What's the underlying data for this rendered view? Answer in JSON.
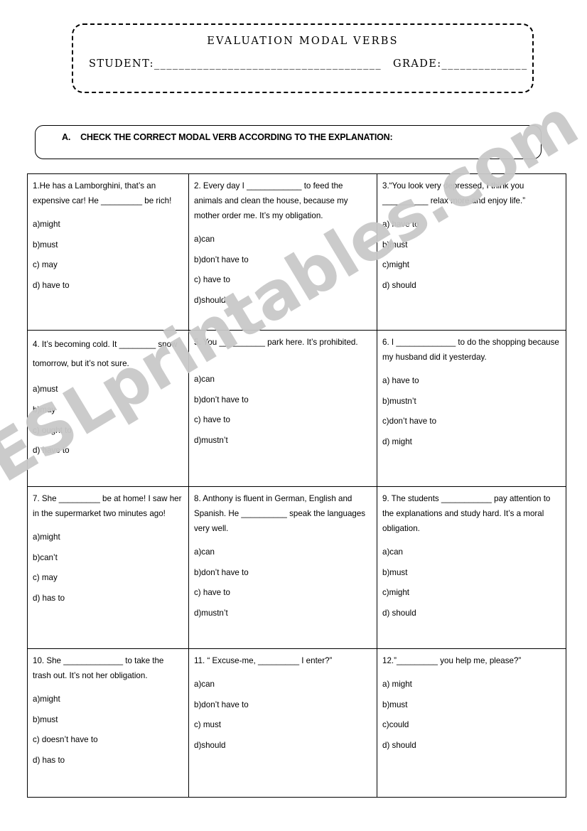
{
  "header": {
    "title": "EVALUATION MODAL VERBS",
    "student_label": "STUDENT:",
    "student_blank": "_____________________________________",
    "grade_label": "GRADE:",
    "grade_blank": "______________"
  },
  "instruction": {
    "letter": "A.",
    "text": "CHECK THE CORRECT MODAL VERB ACCORDING TO THE EXPLANATION:"
  },
  "watermark": {
    "text": "ESLprintables.com",
    "color": "#c9c9c9"
  },
  "questions": [
    {
      "stem": "1.He has a Lamborghini, that’s an expensive car! He _________ be rich!",
      "options": [
        "a)might",
        "b)must",
        "c) may",
        "d) have to"
      ]
    },
    {
      "stem": "2. Every day I ____________ to feed the animals and clean the house, because my mother order me. It’s my obligation.",
      "options": [
        "a)can",
        "b)don’t have to",
        "c) have to",
        "d)should"
      ]
    },
    {
      "stem": "3.“You look very depressed, I think you __________ relax more and enjoy life.”",
      "options": [
        "a) have to",
        "b)must",
        "c)might",
        "d) should"
      ]
    },
    {
      "stem": "4. It’s becoming cold. It ________ snow tomorrow, but it’s not sure.",
      "options": [
        "a)must",
        "b)may",
        "c) ought to",
        "d) have to"
      ],
      "loose_stem": true
    },
    {
      "stem": "5. You __________ park here. It’s prohibited.",
      "options": [
        "a)can",
        "b)don’t have to",
        "c) have to",
        "d)mustn’t"
      ],
      "extra_gap": true
    },
    {
      "stem": "6. I _____________ to do the shopping because my husband did it yesterday.",
      "options": [
        "a) have to",
        "b)mustn’t",
        "c)don’t have to",
        "d) might"
      ]
    },
    {
      "stem": "7. She _________ be at home! I saw her in the supermarket two minutes ago!",
      "options": [
        "a)might",
        "b)can’t",
        "c) may",
        "d) has to"
      ]
    },
    {
      "stem": "8. Anthony is fluent in German, English and Spanish. He __________ speak the languages very well.",
      "options": [
        "a)can",
        "b)don’t have to",
        "c) have to",
        "d)mustn’t"
      ]
    },
    {
      "stem": "9. The students ___________ pay attention to the explanations and study hard. It’s a moral obligation.",
      "options": [
        "a)can",
        "b)must",
        "c)might",
        "d) should"
      ]
    },
    {
      "stem": "10. She _____________ to take the trash out. It’s not her obligation.",
      "options": [
        "a)might",
        "b)must",
        "c) doesn’t have to",
        "d) has to"
      ]
    },
    {
      "stem": "11. “ Excuse-me, _________ I enter?”",
      "options": [
        "a)can",
        "b)don’t have to",
        "c) must",
        "d)should"
      ]
    },
    {
      "stem": "12.”_________ you help me, please?”",
      "options": [
        "a) might",
        "b)must",
        "c)could",
        "d) should"
      ]
    }
  ]
}
